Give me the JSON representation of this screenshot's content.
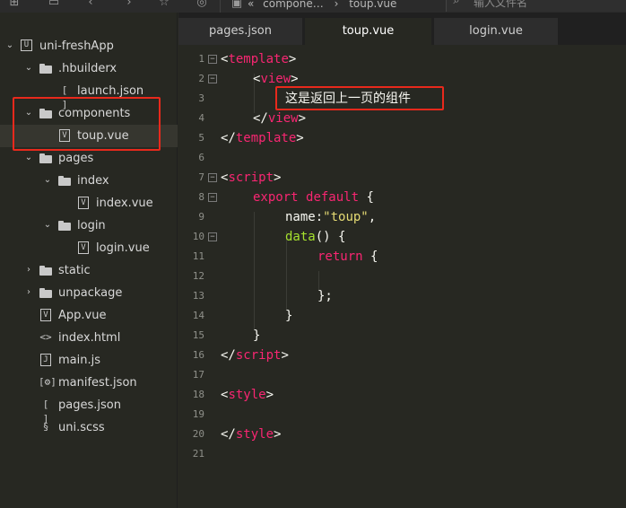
{
  "toolbar": {
    "breadcrumb_prefix": "«",
    "breadcrumb_folder": "compone…",
    "breadcrumb_sep": "›",
    "breadcrumb_file": "toup.vue",
    "search_placeholder": "输入文件名"
  },
  "sidebar": {
    "items": [
      {
        "label": "uni-freshApp"
      },
      {
        "label": ".hbuilderx"
      },
      {
        "label": "launch.json"
      },
      {
        "label": "components"
      },
      {
        "label": "toup.vue"
      },
      {
        "label": "pages"
      },
      {
        "label": "index"
      },
      {
        "label": "index.vue"
      },
      {
        "label": "login"
      },
      {
        "label": "login.vue"
      },
      {
        "label": "static"
      },
      {
        "label": "unpackage"
      },
      {
        "label": "App.vue"
      },
      {
        "label": "index.html"
      },
      {
        "label": "main.js"
      },
      {
        "label": "manifest.json"
      },
      {
        "label": "pages.json"
      },
      {
        "label": "uni.scss"
      }
    ]
  },
  "tabs": [
    {
      "label": "pages.json"
    },
    {
      "label": "toup.vue"
    },
    {
      "label": "login.vue"
    }
  ],
  "editor": {
    "active_file": "toup.vue",
    "line_numbers": [
      "1",
      "2",
      "3",
      "4",
      "5",
      "6",
      "7",
      "8",
      "9",
      "10",
      "11",
      "12",
      "13",
      "14",
      "15",
      "16",
      "17",
      "18",
      "19",
      "20",
      "21"
    ],
    "tokens": {
      "lt": "<",
      "gt": ">",
      "lt_slash": "</",
      "template": "template",
      "view": "view",
      "script": "script",
      "style": "style",
      "export": "export",
      "default": "default",
      "lbrace": "{",
      "rbrace": "}",
      "rbrace_semi": "};",
      "name_key": "name:",
      "name_val": "\"toup\"",
      "comma": ",",
      "data_fn": "data",
      "parens": "() {",
      "return": "return"
    },
    "view_text": "这是返回上一页的组件"
  },
  "colors": {
    "background": "#272822",
    "tag": "#f92672",
    "string": "#e6db74",
    "function": "#a6e22e",
    "highlight_box": "#e8291c"
  }
}
